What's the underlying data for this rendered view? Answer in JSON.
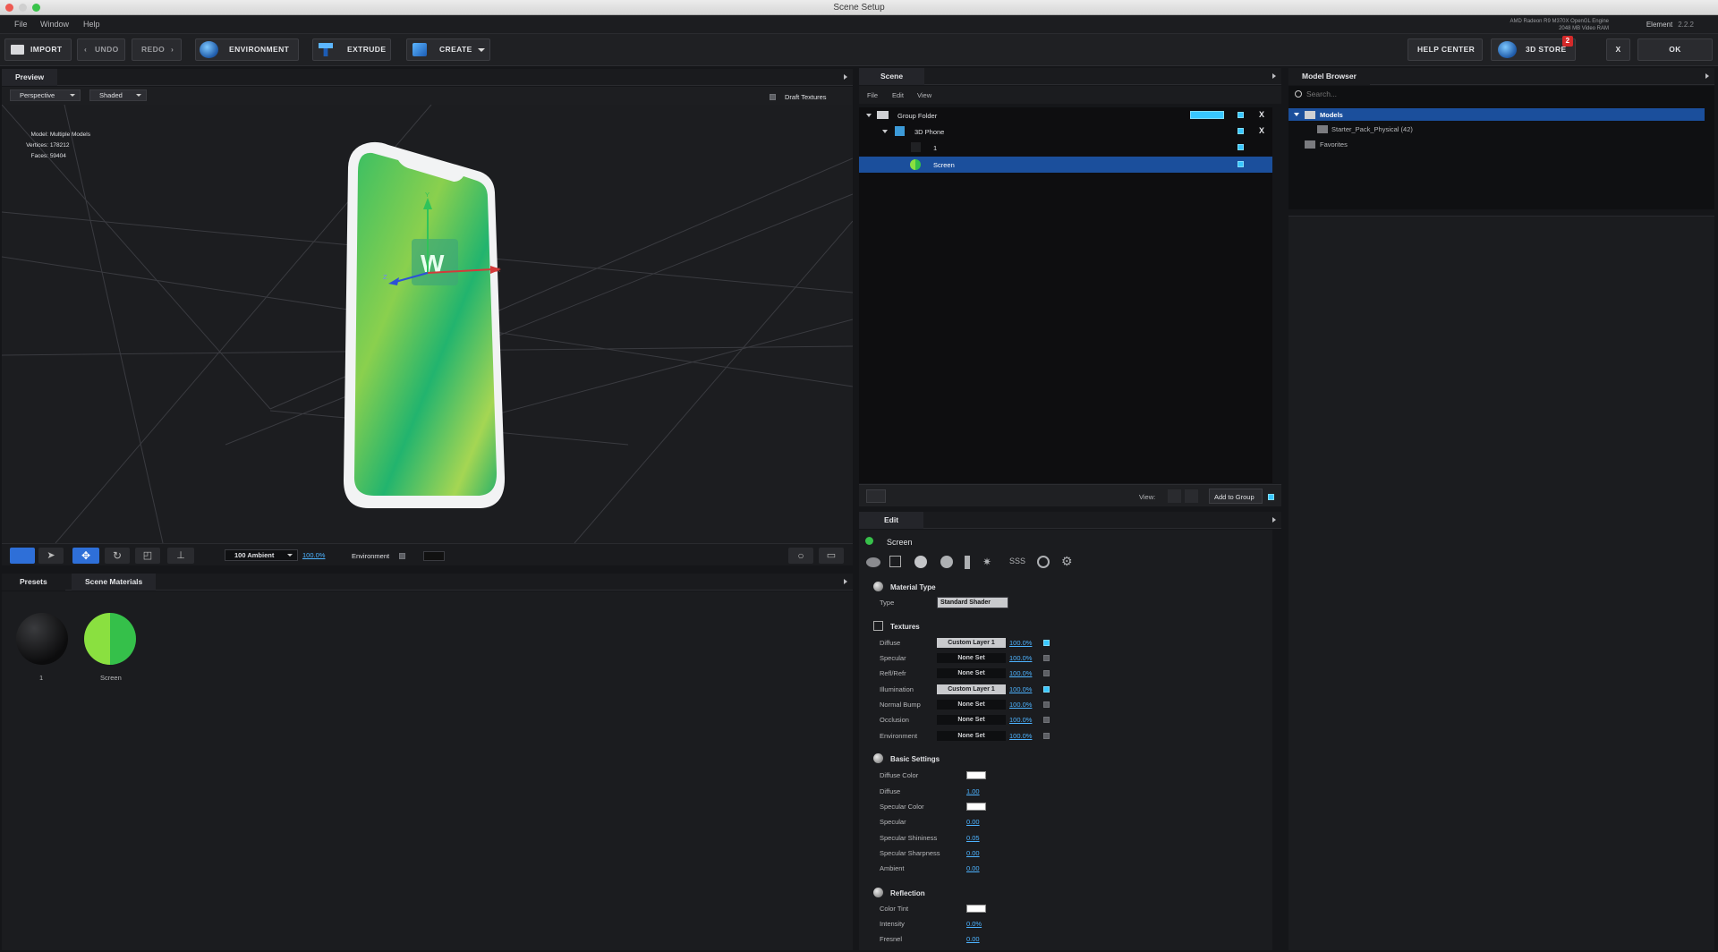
{
  "window": {
    "title": "Scene Setup"
  },
  "menu": [
    "File",
    "Window",
    "Help"
  ],
  "gpu": {
    "name": "AMD Radeon R9 M370X OpenGL Engine",
    "vram": "2048 MB Video RAM"
  },
  "app": {
    "name": "Element",
    "version": "2.2.2"
  },
  "toolbar": {
    "import": "IMPORT",
    "undo": "UNDO",
    "redo": "REDO",
    "environment": "ENVIRONMENT",
    "extrude": "EXTRUDE",
    "create": "CREATE",
    "help_center": "HELP CENTER",
    "store": "3D STORE",
    "store_badge": "2",
    "close": "X",
    "ok": "OK"
  },
  "preview": {
    "tab": "Preview",
    "camera": "Perspective",
    "shading": "Shaded",
    "draft_textures": "Draft Textures",
    "stats": {
      "model_label": "Model:",
      "model": "Multiple Models",
      "vertices_label": "Vertices:",
      "vertices": "178212",
      "faces_label": "Faces:",
      "faces": "59404"
    },
    "gizmo": {
      "x": "X",
      "y": "Y",
      "z": "Z"
    },
    "ambient": "100 Ambient",
    "ambient_value": "100.0%",
    "environment_label": "Environment"
  },
  "presets": {
    "tab_presets": "Presets",
    "tab_materials": "Scene Materials",
    "materials": [
      {
        "label": "1"
      },
      {
        "label": "Screen"
      }
    ]
  },
  "scene": {
    "tab": "Scene",
    "menu": [
      "File",
      "Edit",
      "View"
    ],
    "tree": [
      {
        "label": "Group Folder"
      },
      {
        "label": "3D Phone"
      },
      {
        "label": "1"
      },
      {
        "label": "Screen"
      }
    ],
    "view_label": "View:",
    "add_to_group": "Add to Group"
  },
  "edit": {
    "tab": "Edit",
    "object_name": "Screen",
    "material_type": {
      "title": "Material Type",
      "type_label": "Type",
      "type_value": "Standard Shader"
    },
    "textures": {
      "title": "Textures",
      "rows": [
        {
          "label": "Diffuse",
          "value": "Custom Layer 1",
          "pct": "100.0%",
          "on": true
        },
        {
          "label": "Specular",
          "value": "None Set",
          "pct": "100.0%",
          "on": false
        },
        {
          "label": "Refl/Refr",
          "value": "None Set",
          "pct": "100.0%",
          "on": false
        },
        {
          "label": "Illumination",
          "value": "Custom Layer 1",
          "pct": "100.0%",
          "on": true
        },
        {
          "label": "Normal Bump",
          "value": "None Set",
          "pct": "100.0%",
          "on": false
        },
        {
          "label": "Occlusion",
          "value": "None Set",
          "pct": "100.0%",
          "on": false
        },
        {
          "label": "Environment",
          "value": "None Set",
          "pct": "100.0%",
          "on": false
        }
      ]
    },
    "basic": {
      "title": "Basic Settings",
      "diffuse_color": "Diffuse Color",
      "diffuse": "Diffuse",
      "diffuse_val": "1.00",
      "specular_color": "Specular Color",
      "specular": "Specular",
      "specular_val": "0.00",
      "shininess": "Specular Shininess",
      "shininess_val": "0.05",
      "sharpness": "Specular Sharpness",
      "sharpness_val": "0.00",
      "ambient": "Ambient",
      "ambient_val": "0.00"
    },
    "reflection": {
      "title": "Reflection",
      "tint": "Color Tint",
      "intensity": "Intensity",
      "intensity_val": "0.0%",
      "fresnel": "Fresnel",
      "fresnel_val": "0.00"
    }
  },
  "browser": {
    "tab": "Model Browser",
    "search_placeholder": "Search...",
    "tree": [
      {
        "label": "Models"
      },
      {
        "label": "Starter_Pack_Physical (42)"
      },
      {
        "label": "Favorites"
      }
    ]
  }
}
